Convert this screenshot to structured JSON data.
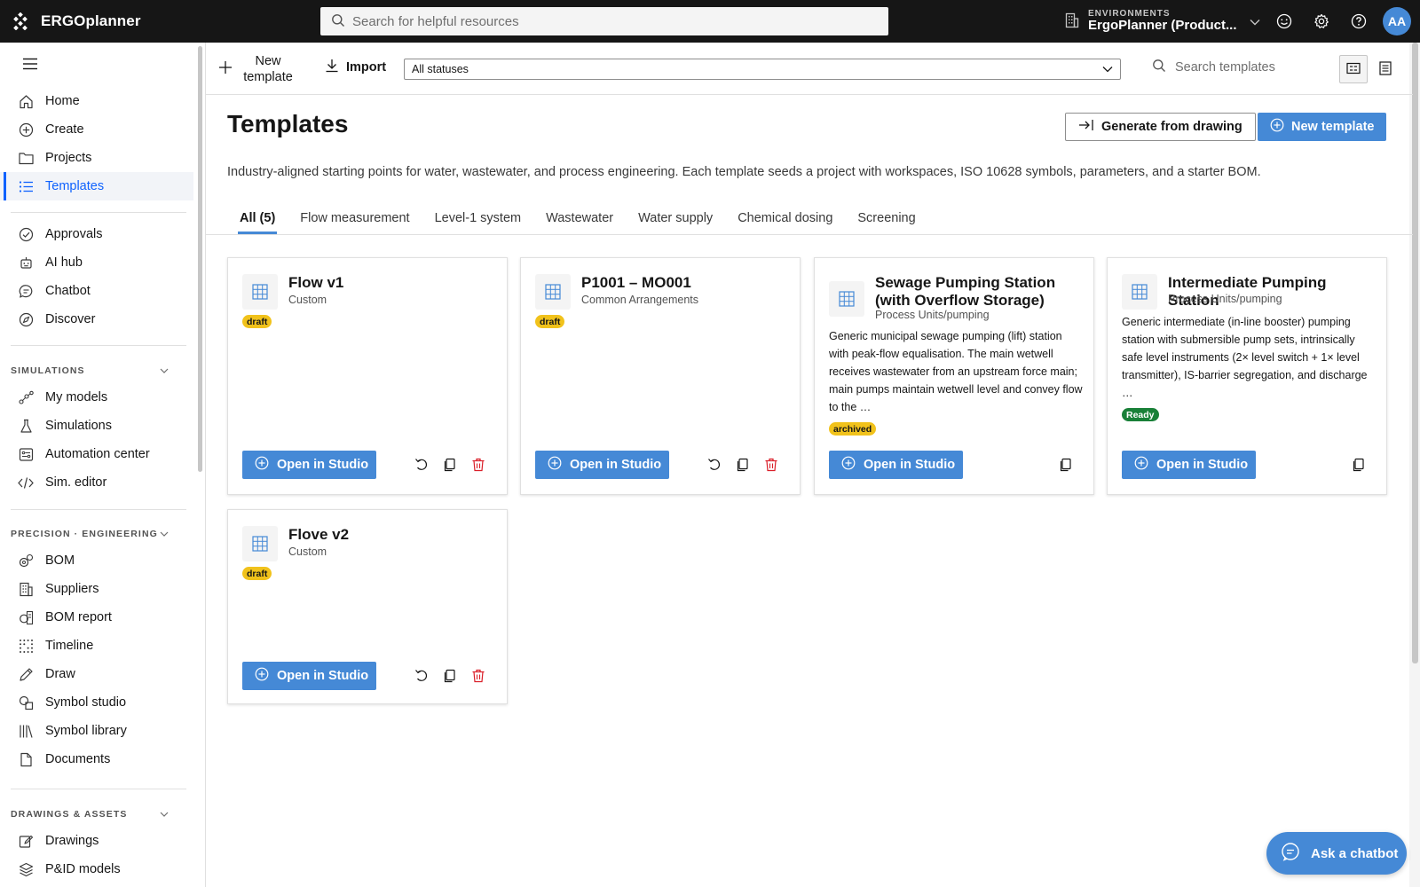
{
  "app": {
    "name": "ERGOplanner"
  },
  "header": {
    "search_placeholder": "Search for helpful resources",
    "env_label": "ENVIRONMENTS",
    "env_value": "ErgoPlanner (Product...",
    "avatar_initials": "AA"
  },
  "sidebar": {
    "primary": [
      {
        "label": "Home",
        "icon": "home-icon"
      },
      {
        "label": "Create",
        "icon": "add-circle-icon"
      },
      {
        "label": "Projects",
        "icon": "folder-icon"
      },
      {
        "label": "Templates",
        "icon": "list-icon",
        "active": true
      }
    ],
    "secondary": [
      {
        "label": "Approvals",
        "icon": "check-circle-icon"
      },
      {
        "label": "AI hub",
        "icon": "robot-icon"
      },
      {
        "label": "Chatbot",
        "icon": "chat-icon"
      },
      {
        "label": "Discover",
        "icon": "compass-icon"
      }
    ],
    "sections": [
      {
        "title": "SIMULATIONS",
        "items": [
          {
            "label": "My models",
            "icon": "model-icon"
          },
          {
            "label": "Simulations",
            "icon": "flask-icon"
          },
          {
            "label": "Automation center",
            "icon": "automation-icon"
          },
          {
            "label": "Sim. editor",
            "icon": "code-icon"
          }
        ]
      },
      {
        "title": "PRECISION · ENGINEERING",
        "items": [
          {
            "label": "BOM",
            "icon": "gears-icon"
          },
          {
            "label": "Suppliers",
            "icon": "building-icon"
          },
          {
            "label": "BOM report",
            "icon": "report-icon"
          },
          {
            "label": "Timeline",
            "icon": "grid-dots-icon"
          },
          {
            "label": "Draw",
            "icon": "pencil-icon"
          },
          {
            "label": "Symbol studio",
            "icon": "shapes-icon"
          },
          {
            "label": "Symbol library",
            "icon": "library-icon"
          },
          {
            "label": "Documents",
            "icon": "document-icon"
          }
        ]
      },
      {
        "title": "DRAWINGS & ASSETS",
        "items": [
          {
            "label": "Drawings",
            "icon": "drawing-icon"
          },
          {
            "label": "P&ID models",
            "icon": "layers-icon"
          }
        ]
      }
    ]
  },
  "toolbar": {
    "new_template": "New template",
    "import": "Import",
    "status_filter": "All statuses",
    "search_placeholder": "Search templates"
  },
  "page": {
    "title": "Templates",
    "generate_button": "Generate from drawing",
    "new_button": "New template",
    "description": "Industry-aligned starting points for water, wastewater, and process engineering. Each template seeds a project with workspaces, ISO 10628 symbols, parameters, and a starter BOM.",
    "tabs": [
      "All (5)",
      "Flow measurement",
      "Level-1 system",
      "Wastewater",
      "Water supply",
      "Chemical dosing",
      "Screening"
    ],
    "active_tab": 0
  },
  "cards": [
    {
      "title": "Flow v1",
      "subtitle": "Custom",
      "status": "draft",
      "description": "",
      "open_label": "Open in Studio"
    },
    {
      "title": "P1001 – MO001",
      "subtitle": "Common Arrangements",
      "status": "draft",
      "description": "",
      "open_label": "Open in Studio"
    },
    {
      "title": "Sewage Pumping Station (with Overflow Storage)",
      "subtitle": "Process Units/pumping",
      "status": "archived",
      "description": "Generic municipal sewage pumping (lift) station with peak-flow equalisation. The main wetwell receives wastewater from an upstream force main; main pumps maintain wetwell level and convey flow to the …",
      "open_label": "Open in Studio"
    },
    {
      "title": "Intermediate Pumping Station",
      "subtitle": "Process Units/pumping",
      "status": "Ready",
      "description": "Generic intermediate (in-line booster) pumping station with submersible pump sets, intrinsically safe level instruments (2× level switch + 1× level transmitter), IS-barrier segregation, and discharge …",
      "open_label": "Open in Studio"
    },
    {
      "title": "Flove v2",
      "subtitle": "Custom",
      "status": "draft",
      "description": "",
      "open_label": "Open in Studio"
    }
  ],
  "chatbot": {
    "label": "Ask a chatbot"
  },
  "colors": {
    "accent": "#4589d6",
    "topbar": "#161616",
    "draft": "#f1c21b",
    "ready": "#198038",
    "delete": "#da1e28"
  }
}
